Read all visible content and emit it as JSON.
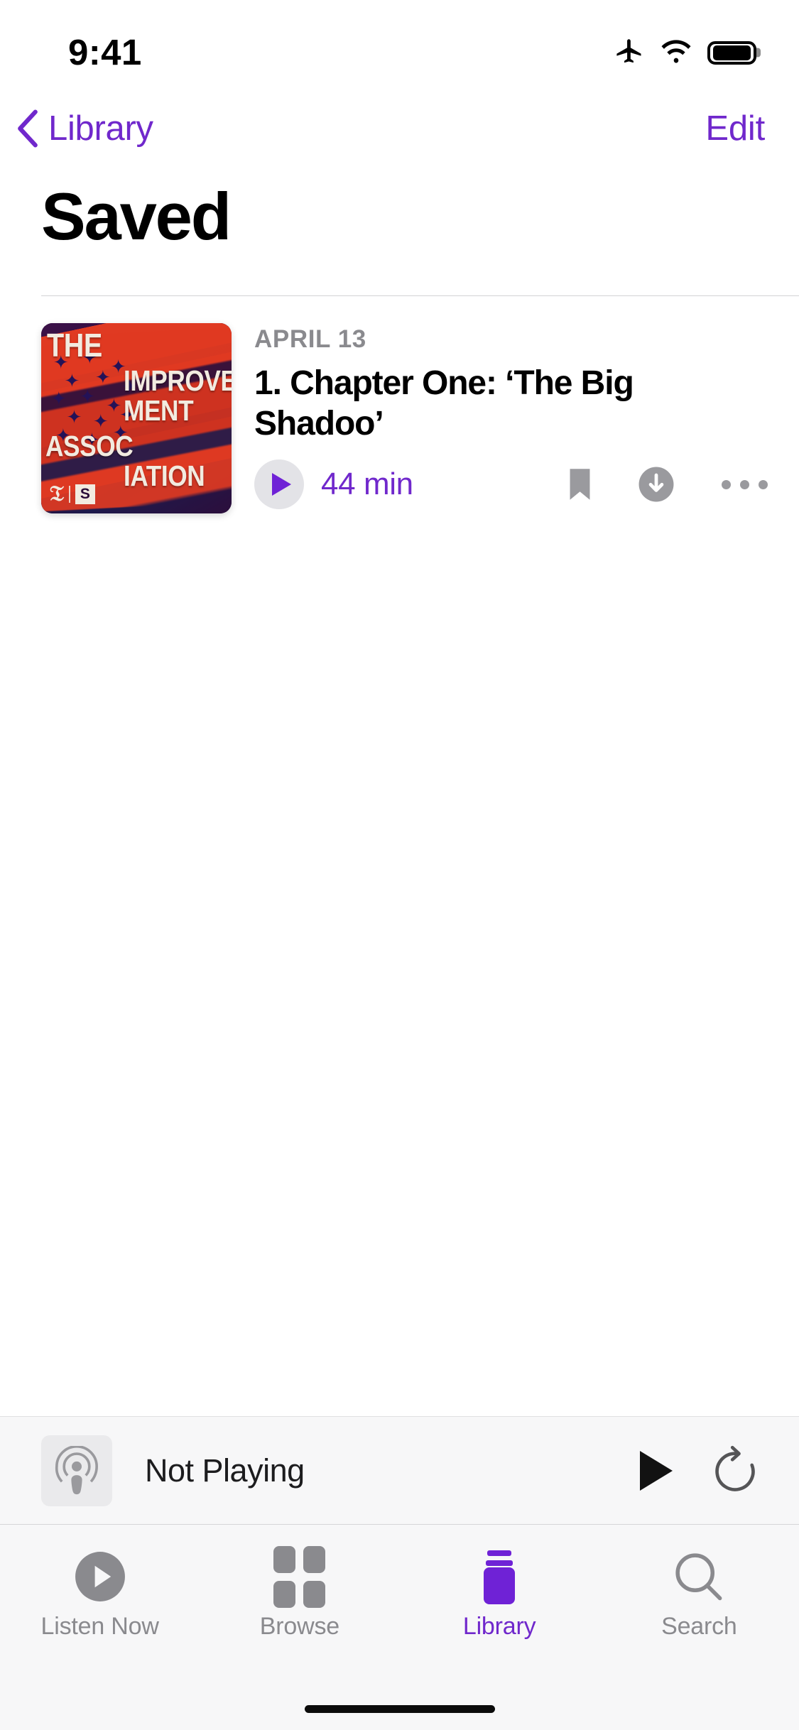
{
  "status_bar": {
    "time": "9:41",
    "icons": [
      "airplane-mode-icon",
      "wifi-icon",
      "battery-icon"
    ]
  },
  "nav_bar": {
    "back_label": "Library",
    "back_icon": "chevron-left-icon",
    "edit_label": "Edit",
    "tint_color": "#7028CC"
  },
  "page_title": "Saved",
  "episodes": [
    {
      "date": "APRIL 13",
      "title": "1. Chapter One: ‘The Big Shadoo’",
      "duration": "44 min",
      "artwork": {
        "title_lines": [
          "THE",
          "IMPROVE",
          "MENT",
          "ASSOC",
          "IATION"
        ],
        "publisher_logo": "𝔗",
        "studio_logo": "S",
        "background_color": "#2C0E3C",
        "accent_color": "#E03A22"
      },
      "actions": [
        {
          "name": "saved-bookmark-icon",
          "label": "Saved"
        },
        {
          "name": "download-icon",
          "label": "Download"
        },
        {
          "name": "more-options-icon",
          "label": "More"
        }
      ]
    }
  ],
  "mini_player": {
    "artwork_icon": "podcasts-app-icon",
    "now_playing_label": "Not Playing",
    "play_label": "Play",
    "skip_forward_label": "Skip Forward"
  },
  "tab_bar": {
    "active_tab": "Library",
    "active_color": "#7028CC",
    "inactive_color": "#8A8A8E",
    "tabs": [
      {
        "label": "Listen Now",
        "icon": "listen-now-icon",
        "active": false
      },
      {
        "label": "Browse",
        "icon": "browse-grid-icon",
        "active": false
      },
      {
        "label": "Library",
        "icon": "library-icon",
        "active": true
      },
      {
        "label": "Search",
        "icon": "search-icon",
        "active": true
      }
    ]
  }
}
